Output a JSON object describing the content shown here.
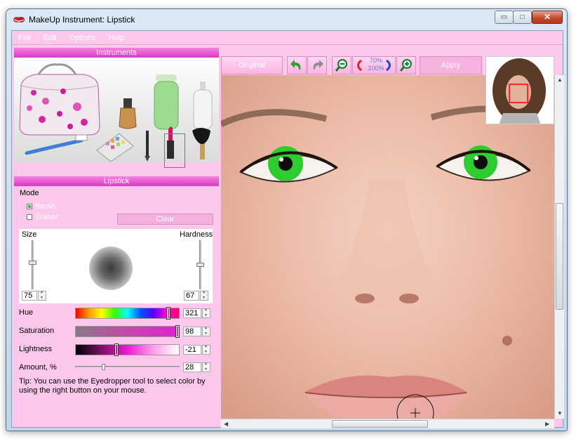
{
  "window": {
    "title": "MakeUp Instrument: Lipstick",
    "controls": {
      "minimize": "▭",
      "maximize": "□",
      "close": "✕"
    }
  },
  "menu": [
    "File",
    "Edit",
    "Options",
    "Help"
  ],
  "instruments_panel": {
    "header": "Instruments",
    "items": [
      "makeup-bag-icon",
      "foundation-bottle-icon",
      "cream-tube-icon",
      "lotion-bottle-icon",
      "toothbrush-icon",
      "eyeshadow-palette-icon",
      "eyeliner-icon",
      "lipstick-icon",
      "powder-brush-icon"
    ],
    "selected": "lipstick-icon"
  },
  "lipstick_panel": {
    "header": "Lipstick",
    "mode_label": "Mode",
    "modes": [
      {
        "label": "Brush",
        "checked": true
      },
      {
        "label": "Eraser",
        "checked": false
      }
    ],
    "clear_label": "Clear",
    "size_label": "Size",
    "hardness_label": "Hardness",
    "size_value": "75",
    "hardness_value": "67",
    "hue": {
      "label": "Hue",
      "value": "321"
    },
    "saturation": {
      "label": "Saturation",
      "value": "98"
    },
    "lightness": {
      "label": "Lightness",
      "value": "-21"
    },
    "amount": {
      "label": "Amount, %",
      "value": "28"
    },
    "tip": "Tip: You can use the Eyedropper tool to select color by using the right button on your mouse."
  },
  "toolbar": {
    "original_label": "Original",
    "apply_label": "Apply",
    "zoom_top": "70%",
    "zoom_bottom": "100%",
    "icons": [
      "undo-icon",
      "redo-icon",
      "zoom-out-icon",
      "rotate-icon",
      "zoom-in-icon"
    ]
  },
  "colors": {
    "panel_bg": "#fdc8ec",
    "header_magenta": "#e048c8",
    "eye_green": "#2ecc2e"
  }
}
